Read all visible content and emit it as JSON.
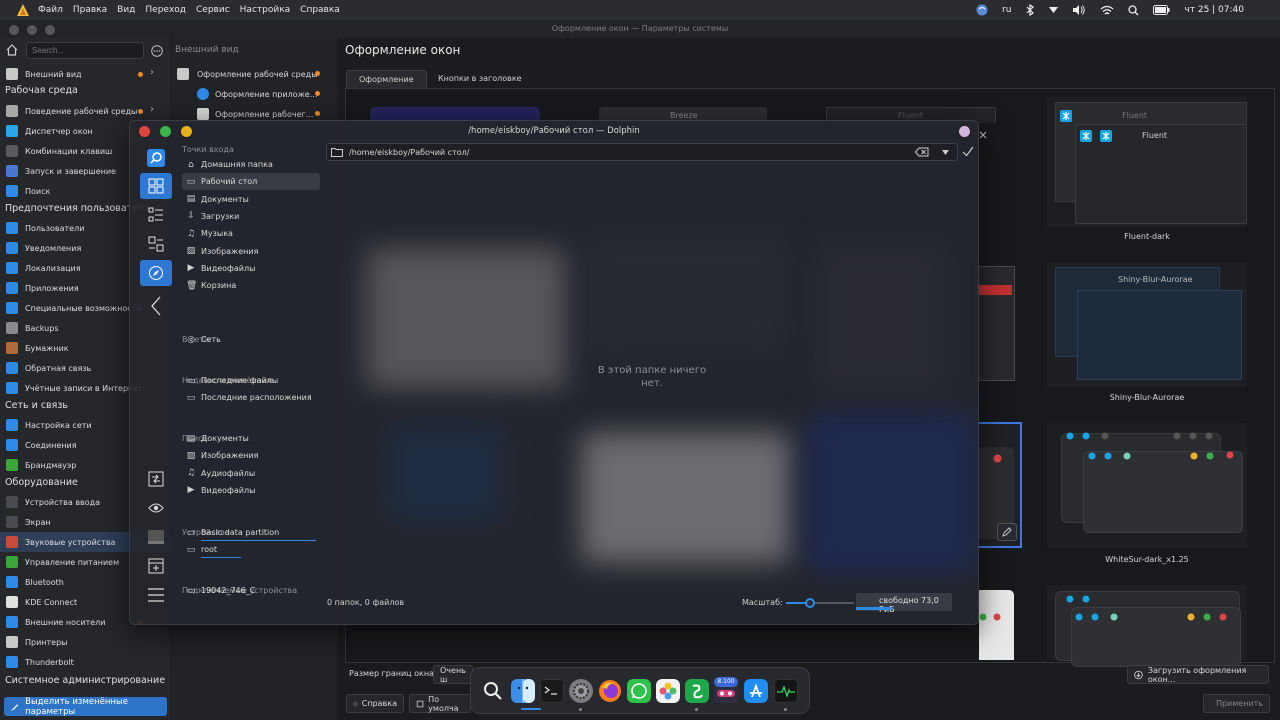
{
  "menubar": {
    "items": [
      "Файл",
      "Правка",
      "Вид",
      "Переход",
      "Сервис",
      "Настройка",
      "Справка"
    ],
    "lang": "ru",
    "datetime": "чт 25 | 07:40"
  },
  "window": {
    "title": "Оформление окон — Параметры системы"
  },
  "sidebar": {
    "search_placeholder": "Search...",
    "items": [
      {
        "label": "Внешний вид",
        "icon": "appearance-icon",
        "color": "#c9c9c9"
      },
      {
        "label": "Поведение рабочей среды",
        "icon": "workspace-icon",
        "color": "#a7a7a7"
      },
      {
        "label": "Диспетчер окон",
        "icon": "window-manager-icon",
        "color": "#2aa5e8"
      },
      {
        "label": "Комбинации клавиш",
        "icon": "shortcuts-icon",
        "color": "#5a5a5f"
      },
      {
        "label": "Запуск и завершение",
        "icon": "startup-icon",
        "color": "#4a78d0"
      },
      {
        "label": "Поиск",
        "icon": "search-icon",
        "color": "#2e8ae6"
      },
      {
        "label": "Пользователи",
        "icon": "users-icon",
        "color": "#2e8ae6"
      },
      {
        "label": "Уведомления",
        "icon": "notifications-icon",
        "color": "#2e8ae6"
      },
      {
        "label": "Локализация",
        "icon": "locale-icon",
        "color": "#2e8ae6"
      },
      {
        "label": "Приложения",
        "icon": "apps-icon",
        "color": "#2e8ae6"
      },
      {
        "label": "Специальные возможности",
        "icon": "accessibility-icon",
        "color": "#2e8ae6"
      },
      {
        "label": "Backups",
        "icon": "backups-icon",
        "color": "#8a8a8f"
      },
      {
        "label": "Бумажник",
        "icon": "wallet-icon",
        "color": "#b06a3a"
      },
      {
        "label": "Обратная связь",
        "icon": "feedback-icon",
        "color": "#2e8ae6"
      },
      {
        "label": "Учётные записи в Интернет",
        "icon": "accounts-icon",
        "color": "#2e8ae6"
      },
      {
        "label": "Настройка сети",
        "icon": "network-icon",
        "color": "#2e8ae6"
      },
      {
        "label": "Соединения",
        "icon": "connections-icon",
        "color": "#2e8ae6"
      },
      {
        "label": "Брандмауэр",
        "icon": "firewall-icon",
        "color": "#3aa63a"
      },
      {
        "label": "Устройства ввода",
        "icon": "input-devices-icon",
        "color": "#4a4a50"
      },
      {
        "label": "Экран",
        "icon": "display-icon",
        "color": "#4a4a50"
      },
      {
        "label": "Звуковые устройства",
        "icon": "audio-icon",
        "color": "#c84a3a"
      },
      {
        "label": "Управление питанием",
        "icon": "power-icon",
        "color": "#3aa63a"
      },
      {
        "label": "Bluetooth",
        "icon": "bluetooth-icon",
        "color": "#2e8ae6"
      },
      {
        "label": "KDE Connect",
        "icon": "kdeconnect-icon",
        "color": "#e0e0e0"
      },
      {
        "label": "Внешние носители",
        "icon": "removable-media-icon",
        "color": "#2e8ae6"
      },
      {
        "label": "Принтеры",
        "icon": "printers-icon",
        "color": "#c9c9c9"
      },
      {
        "label": "Thunderbolt",
        "icon": "thunderbolt-icon",
        "color": "#2e8ae6"
      }
    ],
    "sections": {
      "workspace": "Рабочая среда",
      "personal": "Предпочтения пользователя",
      "network": "Сеть и связь",
      "hardware": "Оборудование",
      "admin": "Системное администрирование"
    },
    "highlight_button": "Выделить изменённые параметры"
  },
  "midcol": {
    "title": "Внешний вид",
    "items": [
      "Оформление рабочей среды",
      "Оформление приложе...",
      "Оформление рабочег..."
    ]
  },
  "main": {
    "title": "Оформление окон",
    "tabs": [
      "Оформление",
      "Кнопки в заголовке"
    ],
    "themes": [
      {
        "name": "Breeze"
      },
      {
        "name": "Fluent"
      },
      {
        "name": "Fluent-dark"
      },
      {
        "name": "Shiny-Blur-Aurorae"
      },
      {
        "name": "WhiteSur-dark_x1.25"
      }
    ],
    "border_size_label": "Размер границ окна:",
    "border_size_value": "Очень ш",
    "download_button": "Загрузить оформления окон...",
    "help_button": "Справка",
    "defaults_button": "По умолча",
    "apply_button": "Применить"
  },
  "dolphin": {
    "title": "/home/eiskboy/Рабочий стол — Dolphin",
    "path": "/home/eiskboy/Рабочий стол/",
    "empty_message": "В этой папке ничего нет.",
    "places_heading": "Точки входа",
    "places": [
      "Домашняя папка",
      "Рабочий стол",
      "Документы",
      "Загрузки",
      "Музыка",
      "Изображения",
      "Видеофайлы",
      "Корзина"
    ],
    "network_heading": "В сети",
    "network": [
      "Сеть"
    ],
    "recent_heading": "Недавно изменённые",
    "recent": [
      "Последние файлы",
      "Последние расположения"
    ],
    "search_heading": "Поиск",
    "search": [
      "Документы",
      "Изображения",
      "Аудиофайлы",
      "Видеофайлы"
    ],
    "devices_heading": "Устройства",
    "devices": [
      "Basic data partition",
      "root"
    ],
    "removable_heading": "Подключаемые устройства",
    "removable": [
      "19042_746_C"
    ],
    "status": "0 папок, 0 файлов",
    "zoom_label": "Масштаб:",
    "free_space": "свободно 73,0 ГиБ",
    "zoom_level": 0.35
  },
  "dock": {
    "apps": [
      "search-app-icon",
      "finder-icon",
      "terminal-icon",
      "settings-gear-icon",
      "firefox-icon",
      "whatsapp-icon",
      "photos-icon",
      "spreadsheet-icon",
      "app-badge-icon",
      "appstore-icon",
      "activity-monitor-icon"
    ],
    "badge": "8.100"
  }
}
